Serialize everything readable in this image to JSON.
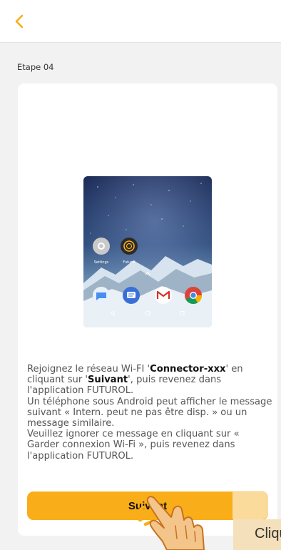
{
  "header": {
    "back_icon": "chevron-left-icon",
    "accent": "#f9ad19"
  },
  "step": {
    "label": "Etape 04"
  },
  "illustration": {
    "icons": [
      "settings-icon",
      "futurol-icon",
      "messages-icon",
      "chat-icon",
      "gmail-icon",
      "chrome-icon"
    ],
    "app_labels": [
      "Settings",
      "Futurol"
    ]
  },
  "instructions": {
    "p1_pre": "Rejoignez le réseau Wi-FI '",
    "p1_network": "Connector-xxx",
    "p1_mid": "' en cliquant sur '",
    "p1_button_ref": "Suivant",
    "p1_post": "', puis revenez dans l'application FUTUROL.",
    "p2": "Un téléphone sous Android peut afficher le message suivant « Intern. peut ne pas être disp. » ou un message similaire.",
    "p3": "Veuillez ignorer ce message en cliquant sur « Garder connexion Wi-Fi », puis revenez dans l'application FUTUROL."
  },
  "next_button": {
    "label": "Suivant"
  },
  "hint": {
    "label": "Cliquez"
  }
}
